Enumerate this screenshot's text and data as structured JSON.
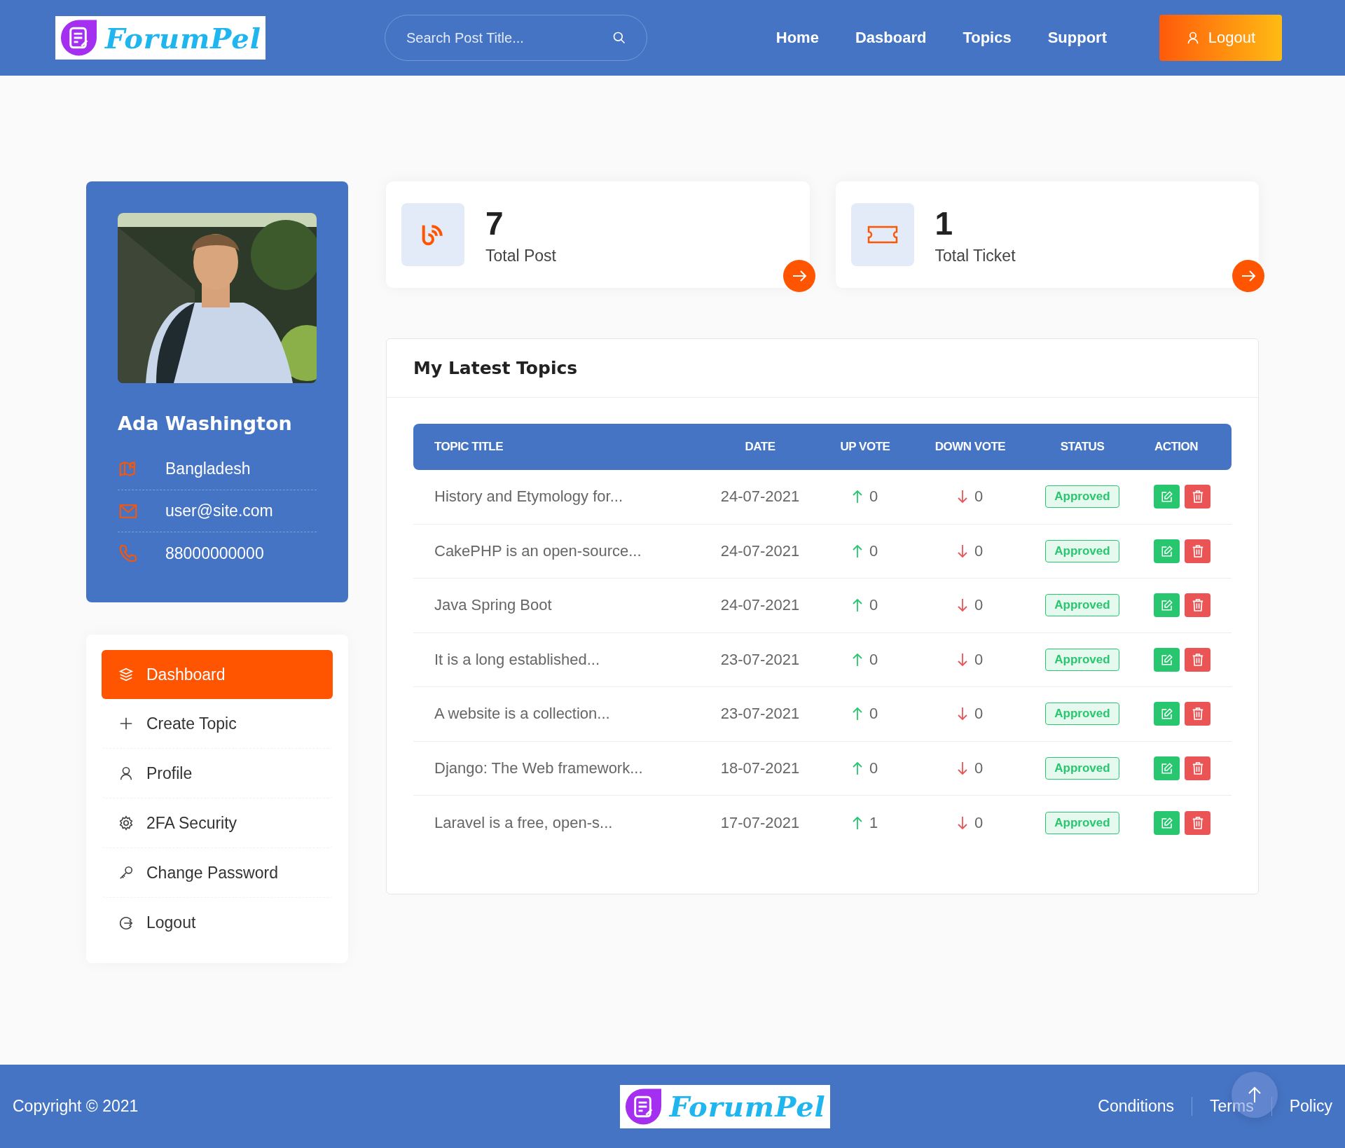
{
  "header": {
    "logo": {
      "text": "ForumPel"
    },
    "search": {
      "placeholder": "Search Post Title..."
    },
    "nav": [
      {
        "label": "Home"
      },
      {
        "label": "Dasboard"
      },
      {
        "label": "Topics"
      },
      {
        "label": "Support"
      }
    ],
    "logout": "Logout"
  },
  "profile": {
    "name": "Ada Washington",
    "details": [
      {
        "kind": "location",
        "text": "Bangladesh"
      },
      {
        "kind": "email",
        "text": "user@site.com"
      },
      {
        "kind": "phone",
        "text": "88000000000"
      }
    ]
  },
  "menu": [
    {
      "kind": "dashboard",
      "label": "Dashboard",
      "selected": true
    },
    {
      "kind": "create",
      "label": "Create Topic",
      "selected": false
    },
    {
      "kind": "profile",
      "label": "Profile",
      "selected": false
    },
    {
      "kind": "security",
      "label": "2FA Security",
      "selected": false
    },
    {
      "kind": "password",
      "label": "Change Password",
      "selected": false
    },
    {
      "kind": "logout",
      "label": "Logout",
      "selected": false
    }
  ],
  "stats": [
    {
      "kind": "post",
      "value": "7",
      "label": "Total Post"
    },
    {
      "kind": "ticket",
      "value": "1",
      "label": "Total Ticket"
    }
  ],
  "topics": {
    "title": "My Latest Topics",
    "columns": [
      "TOPIC TITLE",
      "DATE",
      "UP VOTE",
      "DOWN VOTE",
      "STATUS",
      "ACTION"
    ],
    "rows": [
      {
        "title": "History and Etymology for...",
        "date": "24-07-2021",
        "up": "0",
        "down": "0",
        "status": "Approved"
      },
      {
        "title": "CakePHP is an open-source...",
        "date": "24-07-2021",
        "up": "0",
        "down": "0",
        "status": "Approved"
      },
      {
        "title": "Java Spring Boot",
        "date": "24-07-2021",
        "up": "0",
        "down": "0",
        "status": "Approved"
      },
      {
        "title": "It is a long established...",
        "date": "23-07-2021",
        "up": "0",
        "down": "0",
        "status": "Approved"
      },
      {
        "title": "A website is a collection...",
        "date": "23-07-2021",
        "up": "0",
        "down": "0",
        "status": "Approved"
      },
      {
        "title": "Django: The Web framework...",
        "date": "18-07-2021",
        "up": "0",
        "down": "0",
        "status": "Approved"
      },
      {
        "title": "Laravel is a free, open-s...",
        "date": "17-07-2021",
        "up": "1",
        "down": "0",
        "status": "Approved"
      }
    ]
  },
  "footer": {
    "copyright": "Copyright © 2021",
    "logo": {
      "text": "ForumPel"
    },
    "links": [
      "Conditions",
      "Terms",
      "Policy"
    ]
  }
}
